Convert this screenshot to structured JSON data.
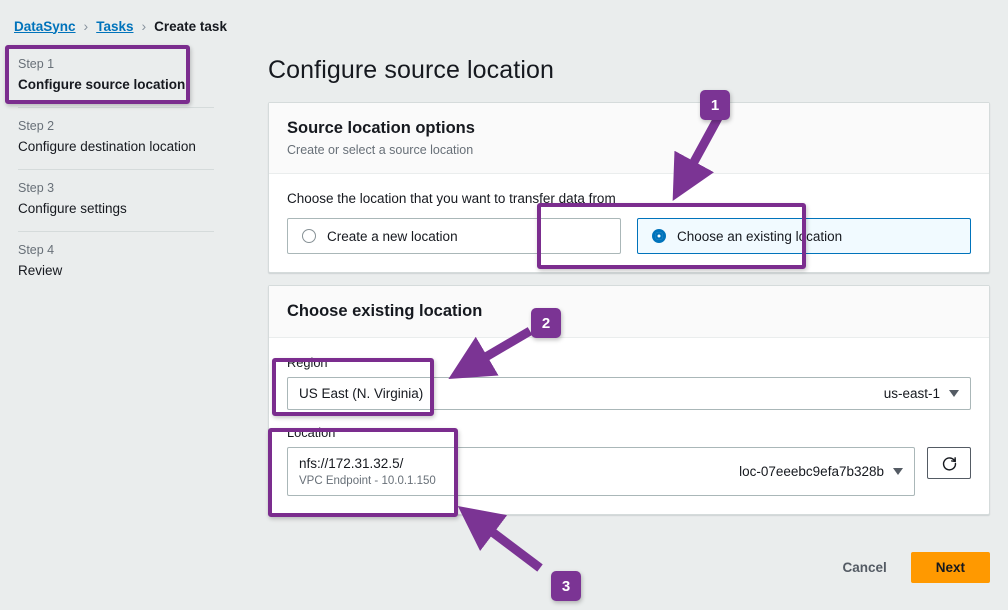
{
  "breadcrumb": {
    "items": [
      {
        "label": "DataSync",
        "link": true
      },
      {
        "label": "Tasks",
        "link": true
      },
      {
        "label": "Create task",
        "link": false
      }
    ],
    "separator": "›"
  },
  "sidebar": {
    "steps": [
      {
        "num": "Step 1",
        "title": "Configure source location",
        "active": true
      },
      {
        "num": "Step 2",
        "title": "Configure destination location",
        "active": false
      },
      {
        "num": "Step 3",
        "title": "Configure settings",
        "active": false
      },
      {
        "num": "Step 4",
        "title": "Review",
        "active": false
      }
    ]
  },
  "main": {
    "page_title": "Configure source location",
    "source_card": {
      "heading": "Source location options",
      "subheading": "Create or select a source location",
      "radio_group_label": "Choose the location that you want to transfer data from",
      "options": [
        {
          "label": "Create a new location",
          "selected": false
        },
        {
          "label": "Choose an existing location",
          "selected": true
        }
      ]
    },
    "existing_card": {
      "heading": "Choose existing location",
      "region_field": {
        "label": "Region",
        "display": "US East (N. Virginia)",
        "value": "us-east-1"
      },
      "location_field": {
        "label": "Location",
        "display": "nfs://172.31.32.5/",
        "sub": "VPC Endpoint - 10.0.1.150",
        "value": "loc-07eeebc9efa7b328b",
        "refresh_icon": "refresh-icon"
      }
    }
  },
  "footer": {
    "cancel_label": "Cancel",
    "next_label": "Next"
  },
  "annotations": {
    "badges": [
      {
        "label": "1"
      },
      {
        "label": "2"
      },
      {
        "label": "3"
      }
    ],
    "highlight_color": "#7b2d8e",
    "accent_color": "#7b3494"
  },
  "colors": {
    "link": "#0073bb",
    "selected_border": "#0073bb",
    "selected_bg": "#f1faff",
    "primary_button": "#ff9900",
    "page_bg": "#eaeded"
  }
}
